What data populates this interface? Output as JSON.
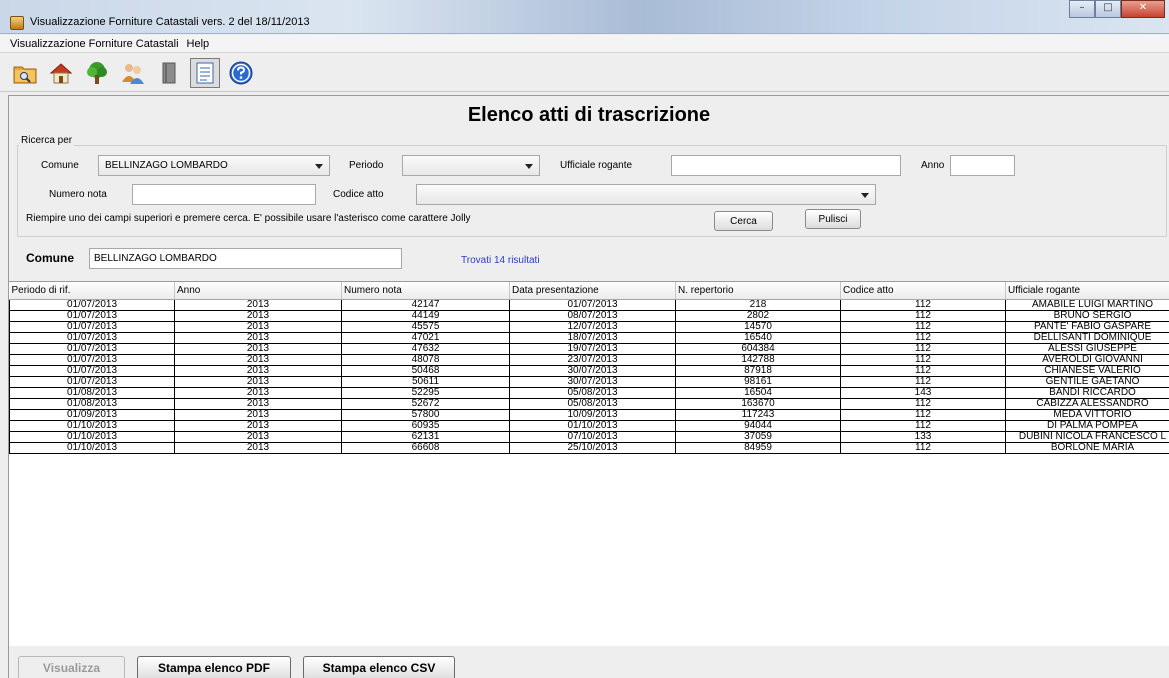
{
  "window": {
    "title": "Visualizzazione Forniture Catastali vers. 2 del 18/11/2013",
    "minimize_glyph": "–",
    "maximize_glyph": "□",
    "close_glyph": "✕"
  },
  "menu": [
    "Visualizzazione Forniture Catastali",
    "Help"
  ],
  "toolbar": {
    "buttons": [
      "folder-search-icon",
      "house-icon",
      "tree-icon",
      "people-icon",
      "book-icon",
      "document-list-icon",
      "help-icon"
    ],
    "pressed": "document-list-icon"
  },
  "page": {
    "title": "Elenco atti di trascrizione",
    "group_label": "Ricerca per"
  },
  "search": {
    "comune_label": "Comune",
    "comune_value": "BELLINZAGO LOMBARDO",
    "periodo_label": "Periodo",
    "periodo_value": "",
    "ufficiale_label": "Ufficiale rogante",
    "ufficiale_value": "",
    "anno_label": "Anno",
    "anno_value": "",
    "numero_nota_label": "Numero nota",
    "numero_nota_value": "",
    "codice_atto_label": "Codice atto",
    "codice_atto_value": "",
    "hint": "Riempire uno dei campi superiori e premere cerca. E' possibile usare l'asterisco come carattere Jolly",
    "cerca_label": "Cerca",
    "pulisci_label": "Pulisci"
  },
  "result": {
    "comune_label": "Comune",
    "comune_value": "BELLINZAGO LOMBARDO",
    "found_text": "Trovati 14 risultati"
  },
  "table": {
    "columns": [
      "Periodo di rif.",
      "Anno",
      "Numero nota",
      "Data presentazione",
      "N. repertorio",
      "Codice atto",
      "Ufficiale rogante"
    ],
    "rows": [
      [
        "01/07/2013",
        "2013",
        "42147",
        "01/07/2013",
        "218",
        "112",
        "AMABILE LUIGI MARTINO"
      ],
      [
        "01/07/2013",
        "2013",
        "44149",
        "08/07/2013",
        "2802",
        "112",
        "BRUNO SERGIO"
      ],
      [
        "01/07/2013",
        "2013",
        "45575",
        "12/07/2013",
        "14570",
        "112",
        "PANTE' FABIO GASPARE"
      ],
      [
        "01/07/2013",
        "2013",
        "47021",
        "18/07/2013",
        "16540",
        "112",
        "DELLISANTI DOMINIQUE"
      ],
      [
        "01/07/2013",
        "2013",
        "47632",
        "19/07/2013",
        "604384",
        "112",
        "ALESSI GIUSEPPE"
      ],
      [
        "01/07/2013",
        "2013",
        "48078",
        "23/07/2013",
        "142788",
        "112",
        "AVEROLDI GIOVANNI"
      ],
      [
        "01/07/2013",
        "2013",
        "50468",
        "30/07/2013",
        "87918",
        "112",
        "CHIANESE VALERIO"
      ],
      [
        "01/07/2013",
        "2013",
        "50611",
        "30/07/2013",
        "98161",
        "112",
        "GENTILE GAETANO"
      ],
      [
        "01/08/2013",
        "2013",
        "52295",
        "05/08/2013",
        "16504",
        "143",
        "BANDI RICCARDO"
      ],
      [
        "01/08/2013",
        "2013",
        "52672",
        "05/08/2013",
        "163670",
        "112",
        "CABIZZA ALESSANDRO"
      ],
      [
        "01/09/2013",
        "2013",
        "57800",
        "10/09/2013",
        "117243",
        "112",
        "MEDA VITTORIO"
      ],
      [
        "01/10/2013",
        "2013",
        "60935",
        "01/10/2013",
        "94044",
        "112",
        "DI PALMA POMPEA"
      ],
      [
        "01/10/2013",
        "2013",
        "62131",
        "07/10/2013",
        "37059",
        "133",
        "DUBINI NICOLA FRANCESCO L"
      ],
      [
        "01/10/2013",
        "2013",
        "66608",
        "25/10/2013",
        "84959",
        "112",
        "BORLONE MARIA"
      ]
    ]
  },
  "footer": {
    "visualizza_label": "Visualizza",
    "pdf_label": "Stampa elenco PDF",
    "csv_label": "Stampa elenco CSV"
  }
}
